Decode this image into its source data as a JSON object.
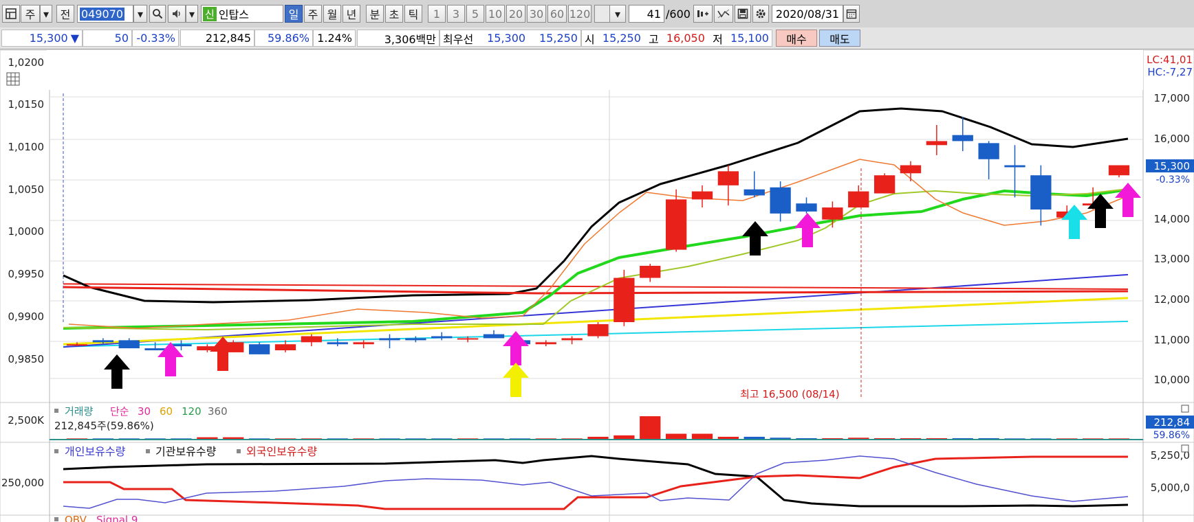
{
  "toolbar": {
    "period_kind": "주",
    "prev_label": "전",
    "stock_code": "049070",
    "credit_badge": "신",
    "stock_name": "인탑스",
    "period_tabs": [
      "일",
      "주",
      "월",
      "년",
      "분",
      "초",
      "틱"
    ],
    "active_period": "일",
    "interval_tabs": [
      "1",
      "3",
      "5",
      "10",
      "20",
      "30",
      "60",
      "120"
    ],
    "count_current": "41",
    "count_total": "/600",
    "date": "2020/08/31"
  },
  "quote": {
    "price": "15,300",
    "change_arrow": "▼",
    "change": "50",
    "change_rate": "-0.33%",
    "volume": "212,845",
    "volume_ratio": "59.86%",
    "turnover": "1.24%",
    "amount": "3,306백만",
    "best_quote_label": "최우선",
    "ask": "15,300",
    "bid": "15,250",
    "open_label": "시",
    "open": "15,250",
    "high_label": "고",
    "high": "16,050",
    "low_label": "저",
    "low": "15,100",
    "buy_label": "매수",
    "sell_label": "매도"
  },
  "colors": {
    "up": "#e8221a",
    "down": "#1a5fc8",
    "volume_bar": "#e8221a"
  },
  "price_chart": {
    "left_axis": [
      "1,0200",
      "1,0150",
      "1,0100",
      "1,0050",
      "1,0000",
      "0,9950",
      "0,9900",
      "0,9850"
    ],
    "right_axis": [
      "17,000",
      "16,000",
      "15,000",
      "14,000",
      "13,000",
      "12,000",
      "11,000",
      "10,000"
    ],
    "lc_label": "LC:41,01",
    "hc_label": "HC:-7,27",
    "price_tag": "15,300",
    "change_tag": "-0.33%",
    "max_note": "최고 16,500 (08/14)"
  },
  "volume_chart": {
    "axis_label": "2,500K",
    "legend_title": "거래량",
    "legend_simple": "단순",
    "ma_periods": [
      "30",
      "60",
      "120",
      "360"
    ],
    "summary": "212,845주(59.86%)",
    "value_tag": "212,84",
    "ratio_tag": "59.86%"
  },
  "holding_chart": {
    "legend": [
      "개인보유수량",
      "기관보유수량",
      "외국인보유수량"
    ],
    "left_axis": "250,000",
    "right_axis": [
      "5,250,0",
      "5,000,0"
    ]
  },
  "obv_chart": {
    "legend": [
      "OBV",
      "Signal 9"
    ]
  },
  "chart_data": {
    "type": "candlestick",
    "candles": [
      {
        "o": 10850,
        "h": 10900,
        "l": 10800,
        "c": 10850
      },
      {
        "o": 10950,
        "h": 11000,
        "l": 10850,
        "c": 10900
      },
      {
        "o": 10950,
        "h": 11000,
        "l": 10750,
        "c": 10750
      },
      {
        "o": 10750,
        "h": 10900,
        "l": 10700,
        "c": 10700
      },
      {
        "o": 10850,
        "h": 10950,
        "l": 10700,
        "c": 10800
      },
      {
        "o": 10700,
        "h": 10850,
        "l": 10650,
        "c": 10800
      },
      {
        "o": 10650,
        "h": 10950,
        "l": 10650,
        "c": 10900
      },
      {
        "o": 10850,
        "h": 10900,
        "l": 10600,
        "c": 10600
      },
      {
        "o": 10700,
        "h": 10950,
        "l": 10650,
        "c": 10850
      },
      {
        "o": 10900,
        "h": 11100,
        "l": 10800,
        "c": 11050
      },
      {
        "o": 10900,
        "h": 11000,
        "l": 10800,
        "c": 10850
      },
      {
        "o": 10850,
        "h": 10950,
        "l": 10750,
        "c": 10900
      },
      {
        "o": 11000,
        "h": 11100,
        "l": 10750,
        "c": 10950
      },
      {
        "o": 11000,
        "h": 11050,
        "l": 10900,
        "c": 10950
      },
      {
        "o": 11050,
        "h": 11150,
        "l": 10950,
        "c": 11000
      },
      {
        "o": 11000,
        "h": 11050,
        "l": 10900,
        "c": 11000
      },
      {
        "o": 11100,
        "h": 11200,
        "l": 11000,
        "c": 11000
      },
      {
        "o": 10950,
        "h": 11050,
        "l": 10800,
        "c": 10850
      },
      {
        "o": 10850,
        "h": 10950,
        "l": 10800,
        "c": 10900
      },
      {
        "o": 10950,
        "h": 11050,
        "l": 10850,
        "c": 11000
      },
      {
        "o": 11050,
        "h": 11400,
        "l": 11000,
        "c": 11350
      },
      {
        "o": 11400,
        "h": 12700,
        "l": 11300,
        "c": 12500
      },
      {
        "o": 12500,
        "h": 12850,
        "l": 12400,
        "c": 12800
      },
      {
        "o": 13200,
        "h": 14700,
        "l": 13150,
        "c": 14450
      },
      {
        "o": 14450,
        "h": 14800,
        "l": 14250,
        "c": 14650
      },
      {
        "o": 14800,
        "h": 15300,
        "l": 14300,
        "c": 15150
      },
      {
        "o": 14700,
        "h": 15150,
        "l": 14500,
        "c": 14550
      },
      {
        "o": 14750,
        "h": 14900,
        "l": 13900,
        "c": 14100
      },
      {
        "o": 14350,
        "h": 14500,
        "l": 14100,
        "c": 14150
      },
      {
        "o": 13950,
        "h": 14400,
        "l": 13750,
        "c": 14250
      },
      {
        "o": 14250,
        "h": 14800,
        "l": 14250,
        "c": 14650
      },
      {
        "o": 14600,
        "h": 15100,
        "l": 14650,
        "c": 15050
      },
      {
        "o": 15100,
        "h": 15400,
        "l": 14900,
        "c": 15300
      },
      {
        "o": 15800,
        "h": 16300,
        "l": 15550,
        "c": 15900
      },
      {
        "o": 16050,
        "h": 16500,
        "l": 15650,
        "c": 15900
      },
      {
        "o": 15850,
        "h": 15900,
        "l": 14950,
        "c": 15450
      },
      {
        "o": 15300,
        "h": 15800,
        "l": 14500,
        "c": 15250
      },
      {
        "o": 15050,
        "h": 15300,
        "l": 13800,
        "c": 14200
      },
      {
        "o": 14000,
        "h": 14300,
        "l": 13950,
        "c": 14150
      },
      {
        "o": 14300,
        "h": 14750,
        "l": 14200,
        "c": 14350
      },
      {
        "o": 15050,
        "h": 15300,
        "l": 15000,
        "c": 15300
      }
    ],
    "ma_lines": [
      {
        "name": "cyan",
        "values": [
          10790,
          11420
        ]
      },
      {
        "name": "blue",
        "values": [
          10780,
          12580
        ]
      },
      {
        "name": "yellow",
        "values": [
          10850,
          12000
        ]
      },
      {
        "name": "red",
        "values": [
          12350,
          12220
        ]
      }
    ]
  }
}
